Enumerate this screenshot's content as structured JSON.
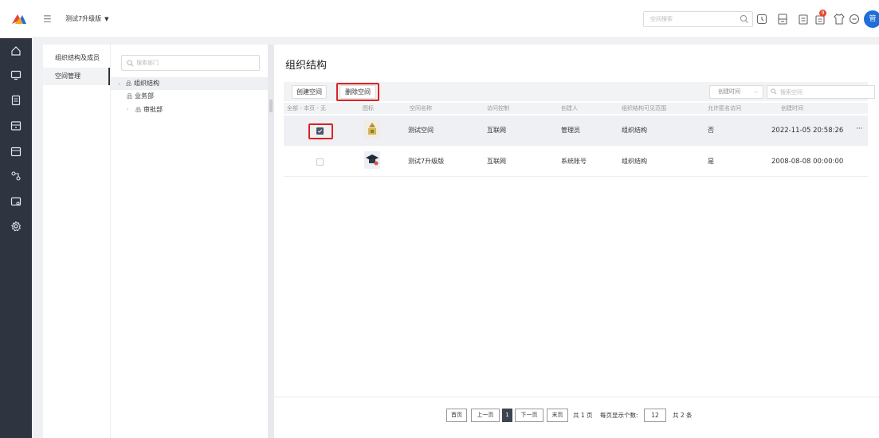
{
  "header": {
    "app_name": "测试7升级版",
    "search_placeholder": "空间搜索",
    "badge_count": "9",
    "avatar_text": "管"
  },
  "subnav": {
    "items": [
      {
        "label": "组织结构及成员"
      },
      {
        "label": "空间管理"
      }
    ]
  },
  "tree": {
    "search_placeholder": "搜索部门",
    "nodes": [
      {
        "label": "组织结构"
      },
      {
        "label": "业务部"
      },
      {
        "label": "审批部"
      }
    ]
  },
  "main": {
    "title": "组织结构",
    "create_button": "创建空间",
    "delete_button": "删除空间",
    "sort_select": "创建时间",
    "table_search_placeholder": "搜索空间",
    "columns": {
      "select": "全部 - 本页 - 无",
      "icon": "图标",
      "name": "空间名称",
      "access": "访问控制",
      "creator": "创建人",
      "scope": "组织结构可见范围",
      "anonymous": "允许匿名访问",
      "created": "创建时间"
    },
    "rows": [
      {
        "name": "测试空间",
        "access": "互联网",
        "creator": "管理员",
        "scope": "组织结构",
        "anonymous": "否",
        "created": "2022-11-05 20:58:26",
        "checked": true,
        "more": "···"
      },
      {
        "name": "测试7升级版",
        "access": "互联网",
        "creator": "系统账号",
        "scope": "组织结构",
        "anonymous": "是",
        "created": "2008-08-08 00:00:00",
        "checked": false
      }
    ]
  },
  "pagination": {
    "first": "首页",
    "prev": "上一页",
    "current": "1",
    "next": "下一页",
    "last": "末页",
    "total_pages_text": "共 1 页",
    "page_size_label": "每页显示个数:",
    "page_size": "12",
    "total_text": "共 2 条"
  },
  "colors": {
    "sidebar_bg": "#2e3440",
    "accent_blue": "#1e6fd9",
    "highlight_red": "#e02020",
    "badge_red": "#e8452f"
  }
}
